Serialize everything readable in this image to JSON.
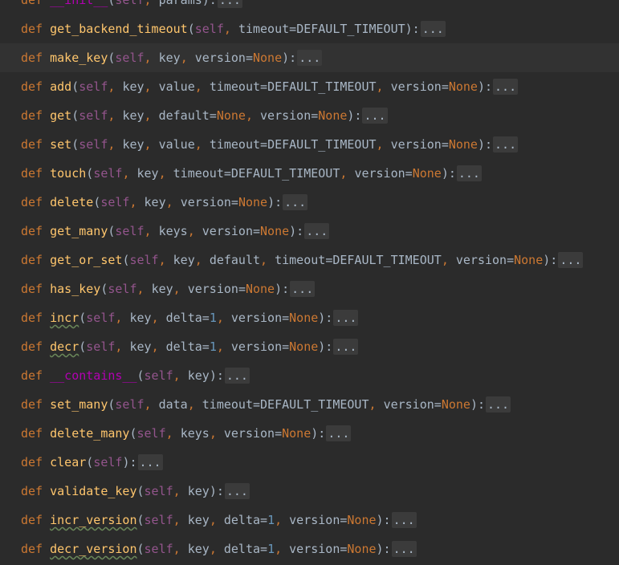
{
  "editor": {
    "lines": [
      {
        "kw": "def",
        "name": "__init__",
        "params": "self, params",
        "fold": "..."
      },
      {
        "kw": "def",
        "name": "get_backend_timeout",
        "params": "self, timeout=DEFAULT_TIMEOUT",
        "fold": "..."
      },
      {
        "kw": "def",
        "name": "make_key",
        "params": "self, key, version=None",
        "fold": "..."
      },
      {
        "kw": "def",
        "name": "add",
        "params": "self, key, value, timeout=DEFAULT_TIMEOUT, version=None",
        "fold": "..."
      },
      {
        "kw": "def",
        "name": "get",
        "params": "self, key, default=None, version=None",
        "fold": "..."
      },
      {
        "kw": "def",
        "name": "set",
        "params": "self, key, value, timeout=DEFAULT_TIMEOUT, version=None",
        "fold": "..."
      },
      {
        "kw": "def",
        "name": "touch",
        "params": "self, key, timeout=DEFAULT_TIMEOUT, version=None",
        "fold": "..."
      },
      {
        "kw": "def",
        "name": "delete",
        "params": "self, key, version=None",
        "fold": "..."
      },
      {
        "kw": "def",
        "name": "get_many",
        "params": "self, keys, version=None",
        "fold": "..."
      },
      {
        "kw": "def",
        "name": "get_or_set",
        "params": "self, key, default, timeout=DEFAULT_TIMEOUT, version=None",
        "fold": "..."
      },
      {
        "kw": "def",
        "name": "has_key",
        "params": "self, key, version=None",
        "fold": "..."
      },
      {
        "kw": "def",
        "name": "incr",
        "params": "self, key, delta=1, version=None",
        "fold": "..."
      },
      {
        "kw": "def",
        "name": "decr",
        "params": "self, key, delta=1, version=None",
        "fold": "..."
      },
      {
        "kw": "def",
        "name": "__contains__",
        "params": "self, key",
        "fold": "..."
      },
      {
        "kw": "def",
        "name": "set_many",
        "params": "self, data, timeout=DEFAULT_TIMEOUT, version=None",
        "fold": "..."
      },
      {
        "kw": "def",
        "name": "delete_many",
        "params": "self, keys, version=None",
        "fold": "..."
      },
      {
        "kw": "def",
        "name": "clear",
        "params": "self",
        "fold": "..."
      },
      {
        "kw": "def",
        "name": "validate_key",
        "params": "self, key",
        "fold": "..."
      },
      {
        "kw": "def",
        "name": "incr_version",
        "params": "self, key, delta=1, version=None",
        "fold": "..."
      },
      {
        "kw": "def",
        "name": "decr_version",
        "params": "self, key, delta=1, version=None",
        "fold": "..."
      }
    ]
  }
}
